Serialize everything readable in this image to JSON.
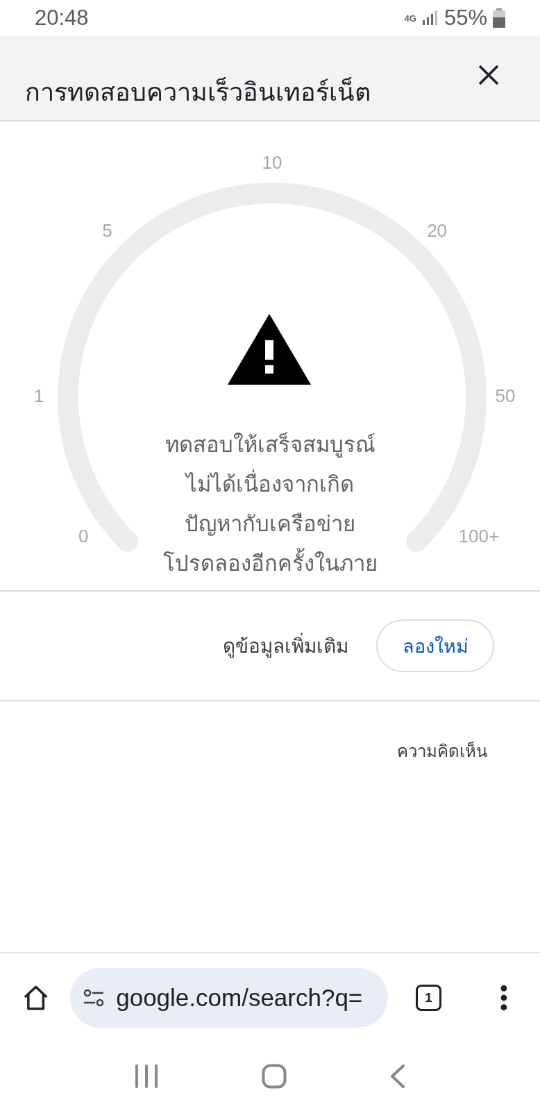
{
  "status_bar": {
    "time": "20:48",
    "network": "4G",
    "battery": "55%"
  },
  "header": {
    "title": "การทดสอบความเร็วอินเทอร์เน็ต"
  },
  "gauge": {
    "ticks": [
      "0",
      "1",
      "5",
      "10",
      "20",
      "50",
      "100+"
    ],
    "message": [
      "ทดสอบให้เสร็จสมบูรณ์",
      "ไม่ได้เนื่องจากเกิด",
      "ปัญหากับเครือข่าย",
      "โปรดลองอีกครั้งในภาย"
    ]
  },
  "actions": {
    "more_info": "ดูข้อมูลเพิ่มเติม",
    "retry": "ลองใหม่"
  },
  "feedback": "ความคิดเห็น",
  "browser_bar": {
    "url": "google.com/search?q=",
    "tab_count": "1"
  }
}
